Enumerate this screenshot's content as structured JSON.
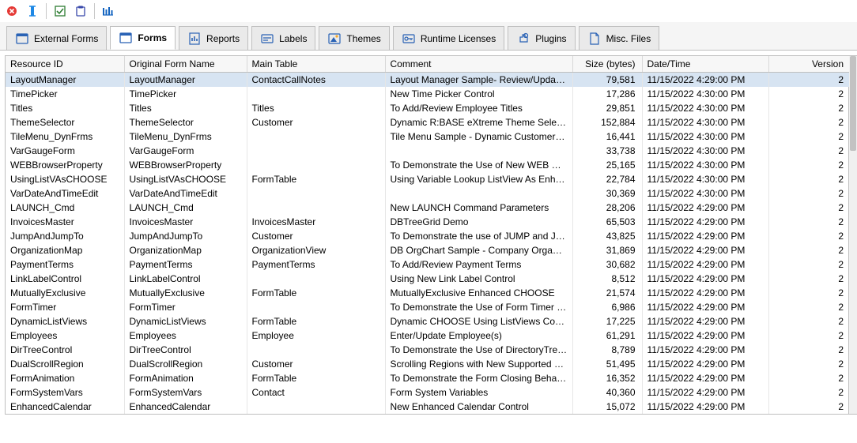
{
  "toolbar": {
    "icons": [
      "close-icon",
      "rename-icon",
      "check-icon",
      "clipboard-icon",
      "columns-icon"
    ]
  },
  "tabs": [
    {
      "label": "External Forms",
      "icon": "form-icon"
    },
    {
      "label": "Forms",
      "icon": "form-icon",
      "active": true
    },
    {
      "label": "Reports",
      "icon": "report-icon"
    },
    {
      "label": "Labels",
      "icon": "label-icon"
    },
    {
      "label": "Themes",
      "icon": "theme-icon"
    },
    {
      "label": "Runtime Licenses",
      "icon": "key-icon"
    },
    {
      "label": "Plugins",
      "icon": "plugin-icon"
    },
    {
      "label": "Misc. Files",
      "icon": "file-icon"
    }
  ],
  "grid": {
    "headers": {
      "resource_id": "Resource ID",
      "original": "Original Form Name",
      "main_table": "Main Table",
      "comment": "Comment",
      "size": "Size (bytes)",
      "datetime": "Date/Time",
      "version": "Version"
    },
    "rows": [
      {
        "rid": "LayoutManager",
        "orig": "LayoutManager",
        "main": "ContactCallNotes",
        "comm": "Layout Manager Sample- Review/Update C...",
        "size": "79,581",
        "dt": "11/15/2022 4:29:00 PM",
        "ver": "2",
        "selected": true
      },
      {
        "rid": "TimePicker",
        "orig": "TimePicker",
        "main": "",
        "comm": "New Time Picker Control",
        "size": "17,286",
        "dt": "11/15/2022 4:30:00 PM",
        "ver": "2"
      },
      {
        "rid": "Titles",
        "orig": "Titles",
        "main": "Titles",
        "comm": "To Add/Review Employee Titles",
        "size": "29,851",
        "dt": "11/15/2022 4:30:00 PM",
        "ver": "2"
      },
      {
        "rid": "ThemeSelector",
        "orig": "ThemeSelector",
        "main": "Customer",
        "comm": "Dynamic R:BASE eXtreme Theme Selector",
        "size": "152,884",
        "dt": "11/15/2022 4:30:00 PM",
        "ver": "2"
      },
      {
        "rid": "TileMenu_DynFrms",
        "orig": "TileMenu_DynFrms",
        "main": "",
        "comm": "Tile Menu Sample - Dynamic Customer Tiles",
        "size": "16,441",
        "dt": "11/15/2022 4:30:00 PM",
        "ver": "2"
      },
      {
        "rid": "VarGaugeForm",
        "orig": "VarGaugeForm",
        "main": "",
        "comm": "",
        "size": "33,738",
        "dt": "11/15/2022 4:30:00 PM",
        "ver": "2"
      },
      {
        "rid": "WEBBrowserProperty",
        "orig": "WEBBrowserProperty",
        "main": "",
        "comm": "To Demonstrate the Use of New WEB Browe...",
        "size": "25,165",
        "dt": "11/15/2022 4:30:00 PM",
        "ver": "2"
      },
      {
        "rid": "UsingListVAsCHOOSE",
        "orig": "UsingListVAsCHOOSE",
        "main": "FormTable",
        "comm": "Using Variable Lookup ListView As Enhance...",
        "size": "22,784",
        "dt": "11/15/2022 4:30:00 PM",
        "ver": "2"
      },
      {
        "rid": "VarDateAndTimeEdit",
        "orig": "VarDateAndTimeEdit",
        "main": "",
        "comm": "",
        "size": "30,369",
        "dt": "11/15/2022 4:30:00 PM",
        "ver": "2"
      },
      {
        "rid": "LAUNCH_Cmd",
        "orig": "LAUNCH_Cmd",
        "main": "",
        "comm": "New LAUNCH Command Parameters",
        "size": "28,206",
        "dt": "11/15/2022 4:29:00 PM",
        "ver": "2"
      },
      {
        "rid": "InvoicesMaster",
        "orig": "InvoicesMaster",
        "main": "InvoicesMaster",
        "comm": "DBTreeGrid Demo",
        "size": "65,503",
        "dt": "11/15/2022 4:29:00 PM",
        "ver": "2"
      },
      {
        "rid": "JumpAndJumpTo",
        "orig": "JumpAndJumpTo",
        "main": "Customer",
        "comm": "To Demonstrate the use of JUMP and JUMP...",
        "size": "43,825",
        "dt": "11/15/2022 4:29:00 PM",
        "ver": "2"
      },
      {
        "rid": "OrganizationMap",
        "orig": "OrganizationMap",
        "main": "OrganizationView",
        "comm": "DB OrgChart Sample - Company Organizati...",
        "size": "31,869",
        "dt": "11/15/2022 4:29:00 PM",
        "ver": "2"
      },
      {
        "rid": "PaymentTerms",
        "orig": "PaymentTerms",
        "main": "PaymentTerms",
        "comm": "To Add/Review Payment Terms",
        "size": "30,682",
        "dt": "11/15/2022 4:29:00 PM",
        "ver": "2"
      },
      {
        "rid": "LinkLabelControl",
        "orig": "LinkLabelControl",
        "main": "",
        "comm": "Using New Link Label Control",
        "size": "8,512",
        "dt": "11/15/2022 4:29:00 PM",
        "ver": "2"
      },
      {
        "rid": "MutuallyExclusive",
        "orig": "MutuallyExclusive",
        "main": "FormTable",
        "comm": "MutuallyExclusive Enhanced CHOOSE",
        "size": "21,574",
        "dt": "11/15/2022 4:29:00 PM",
        "ver": "2"
      },
      {
        "rid": "FormTimer",
        "orig": "FormTimer",
        "main": "",
        "comm": "To Demonstrate the Use of Form Timer Prop...",
        "size": "6,986",
        "dt": "11/15/2022 4:29:00 PM",
        "ver": "2"
      },
      {
        "rid": "DynamicListViews",
        "orig": "DynamicListViews",
        "main": "FormTable",
        "comm": "Dynamic CHOOSE Using ListViews Control",
        "size": "17,225",
        "dt": "11/15/2022 4:29:00 PM",
        "ver": "2"
      },
      {
        "rid": "Employees",
        "orig": "Employees",
        "main": "Employee",
        "comm": "Enter/Update Employee(s)",
        "size": "61,291",
        "dt": "11/15/2022 4:29:00 PM",
        "ver": "2"
      },
      {
        "rid": "DirTreeControl",
        "orig": "DirTreeControl",
        "main": "",
        "comm": "To Demonstrate the Use of DirectoryTree Co...",
        "size": "8,789",
        "dt": "11/15/2022 4:29:00 PM",
        "ver": "2"
      },
      {
        "rid": "DualScrollRegion",
        "orig": "DualScrollRegion",
        "main": "Customer",
        "comm": "Scrolling Regions with New Supported Cont...",
        "size": "51,495",
        "dt": "11/15/2022 4:29:00 PM",
        "ver": "2"
      },
      {
        "rid": "FormAnimation",
        "orig": "FormAnimation",
        "main": "FormTable",
        "comm": "To Demonstrate the Form Closing Behavior ...",
        "size": "16,352",
        "dt": "11/15/2022 4:29:00 PM",
        "ver": "2"
      },
      {
        "rid": "FormSystemVars",
        "orig": "FormSystemVars",
        "main": "Contact",
        "comm": "Form System Variables",
        "size": "40,360",
        "dt": "11/15/2022 4:29:00 PM",
        "ver": "2"
      },
      {
        "rid": "EnhancedCalendar",
        "orig": "EnhancedCalendar",
        "main": "",
        "comm": "New Enhanced Calendar Control",
        "size": "15,072",
        "dt": "11/15/2022 4:29:00 PM",
        "ver": "2"
      }
    ]
  }
}
